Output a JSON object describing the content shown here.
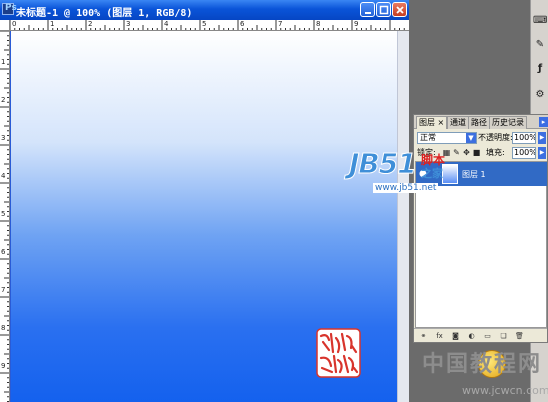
{
  "document": {
    "title": "未标题-1 @ 100% (图层 1, RGB/8)",
    "app_icon_letter": "Ps",
    "ruler_top_labels": [
      "0",
      "1",
      "2",
      "3",
      "4",
      "5",
      "6",
      "7",
      "8",
      "9"
    ],
    "ruler_left_labels": [
      "1",
      "2",
      "3",
      "4",
      "5",
      "6",
      "7",
      "8",
      "9"
    ],
    "canvas_gradient": [
      "#ffffff",
      "#1461ee"
    ]
  },
  "layers_panel": {
    "tabs": [
      "图层 ×",
      "通道",
      "路径",
      "历史记录"
    ],
    "blend_mode": "正常",
    "opacity_label": "不透明度:",
    "opacity_value": "100%",
    "lock_label": "锁定:",
    "fill_label": "填充:",
    "fill_value": "100%",
    "layers": [
      {
        "name": "图层 1",
        "selected": true
      }
    ],
    "bottom_icons": [
      "link-icon",
      "fx-icon",
      "mask-icon",
      "adjustment-icon",
      "folder-icon",
      "new-layer-icon",
      "trash-icon"
    ]
  },
  "watermarks": {
    "jb51_logo": "JB51",
    "jb51_cn_top": "脚本",
    "jb51_cn_bottom": "之家",
    "jb51_url": "www.jb51.net",
    "cw_cn": "中国教程网",
    "cw_url": "www.jcwcn.com"
  },
  "colors": {
    "accent": "#316ac5",
    "titlebar": "#0a54d8",
    "canvas_top": "#ffffff",
    "canvas_bottom": "#1461ee"
  }
}
